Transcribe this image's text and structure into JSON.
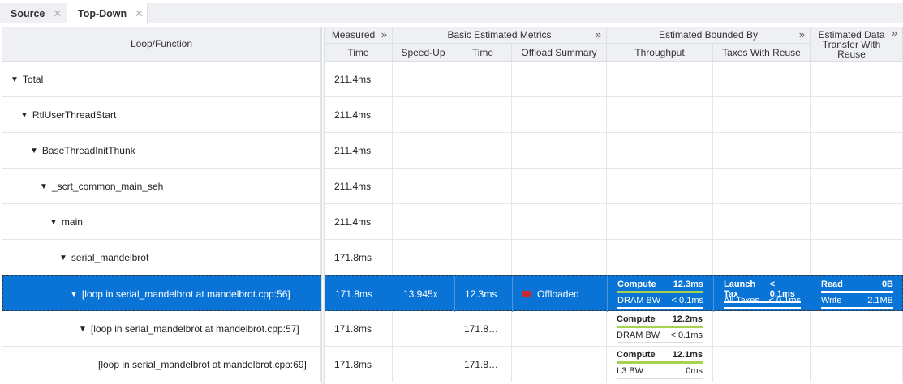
{
  "tabs": [
    {
      "label": "Source",
      "close": "✕"
    },
    {
      "label": "Top-Down",
      "close": "✕"
    }
  ],
  "headers": {
    "loop_function": "Loop/Function",
    "measured": "Measured",
    "basic": "Basic Estimated Metrics",
    "bounded": "Estimated Bounded By",
    "data_transfer": "Estimated Data Transfer With Reuse",
    "expand": "»",
    "time": "Time",
    "speedup": "Speed-Up",
    "est_time": "Time",
    "offload_summary": "Offload Summary",
    "throughput": "Throughput",
    "taxes": "Taxes With Reuse"
  },
  "rows": [
    {
      "name": "Total",
      "time": "211.4ms"
    },
    {
      "name": "RtlUserThreadStart",
      "time": "211.4ms"
    },
    {
      "name": "BaseThreadInitThunk",
      "time": "211.4ms"
    },
    {
      "name": "_scrt_common_main_seh",
      "time": "211.4ms"
    },
    {
      "name": "main",
      "time": "211.4ms"
    },
    {
      "name": "serial_mandelbrot",
      "time": "171.8ms"
    },
    {
      "name": "[loop in serial_mandelbrot at mandelbrot.cpp:56]",
      "time": "171.8ms",
      "speedup": "13.945x",
      "est_time": "12.3ms",
      "offload": "Offloaded",
      "tp": [
        [
          "Compute",
          "12.3ms"
        ],
        [
          "DRAM BW",
          "< 0.1ms"
        ]
      ],
      "tax": [
        [
          "Launch Tax",
          "< 0.1ms"
        ],
        [
          "All Taxes",
          "< 0.1ms"
        ]
      ],
      "dt": [
        [
          "Read",
          "0B"
        ],
        [
          "Write",
          "2.1MB"
        ]
      ]
    },
    {
      "name": "[loop in serial_mandelbrot at mandelbrot.cpp:57]",
      "time": "171.8ms",
      "est_time": "171.8…",
      "tp": [
        [
          "Compute",
          "12.2ms"
        ],
        [
          "DRAM BW",
          "< 0.1ms"
        ]
      ]
    },
    {
      "name": "[loop in serial_mandelbrot at mandelbrot.cpp:69]",
      "time": "171.8ms",
      "est_time": "171.8…",
      "tp": [
        [
          "Compute",
          "12.1ms"
        ],
        [
          "L3 BW",
          "0ms"
        ]
      ]
    }
  ],
  "triangle": "▼"
}
